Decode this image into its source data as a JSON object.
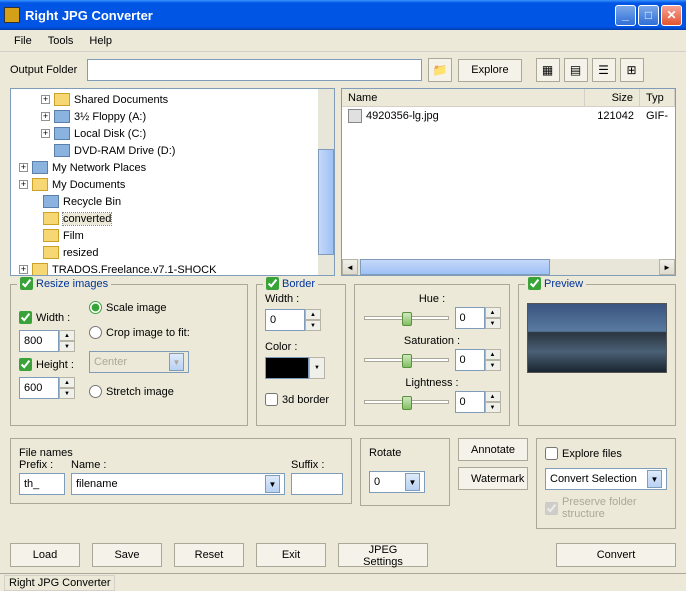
{
  "window": {
    "title": "Right JPG Converter"
  },
  "menu": {
    "file": "File",
    "tools": "Tools",
    "help": "Help"
  },
  "toolbar": {
    "output_folder_label": "Output Folder",
    "output_folder_value": "",
    "explore": "Explore"
  },
  "tree": {
    "items": [
      {
        "indent": 28,
        "expand": "+",
        "icon": "folder",
        "label": "Shared Documents"
      },
      {
        "indent": 28,
        "expand": "+",
        "icon": "special",
        "label": "3½ Floppy (A:)"
      },
      {
        "indent": 28,
        "expand": "+",
        "icon": "special",
        "label": "Local Disk (C:)"
      },
      {
        "indent": 28,
        "expand": "",
        "icon": "special",
        "label": "DVD-RAM Drive (D:)"
      },
      {
        "indent": 6,
        "expand": "+",
        "icon": "special",
        "label": "My Network Places"
      },
      {
        "indent": 6,
        "expand": "+",
        "icon": "folder",
        "label": "My Documents"
      },
      {
        "indent": 17,
        "expand": "",
        "icon": "special",
        "label": "Recycle Bin"
      },
      {
        "indent": 17,
        "expand": "",
        "icon": "folder",
        "label": "converted",
        "selected": true
      },
      {
        "indent": 17,
        "expand": "",
        "icon": "folder",
        "label": "Film"
      },
      {
        "indent": 17,
        "expand": "",
        "icon": "folder",
        "label": "resized"
      },
      {
        "indent": 6,
        "expand": "+",
        "icon": "folder",
        "label": "TRADOS.Freelance.v7.1-SHOCK"
      }
    ]
  },
  "list": {
    "cols": {
      "name": "Name",
      "size": "Size",
      "type": "Typ"
    },
    "rows": [
      {
        "name": "4920356-lg.jpg",
        "size": "121042",
        "type": "GIF-"
      }
    ]
  },
  "resize": {
    "title": "Resize images",
    "width_label": "Width :",
    "width_val": "800",
    "height_label": "Height :",
    "height_val": "600",
    "scale": "Scale image",
    "crop": "Crop image to fit:",
    "center": "Center",
    "stretch": "Stretch image"
  },
  "border": {
    "title": "Border",
    "width_label": "Width :",
    "width_val": "0",
    "color_label": "Color :",
    "threed": "3d border"
  },
  "hsl": {
    "hue": "Hue :",
    "hue_val": "0",
    "sat": "Saturation :",
    "sat_val": "0",
    "light": "Lightness :",
    "light_val": "0"
  },
  "preview": {
    "title": "Preview"
  },
  "filenames": {
    "title": "File names",
    "prefix_label": "Prefix :",
    "prefix_val": "th_",
    "name_label": "Name :",
    "name_val": "filename",
    "suffix_label": "Suffix :",
    "suffix_val": ""
  },
  "rotate": {
    "title": "Rotate",
    "val": "0"
  },
  "aw": {
    "annotate": "Annotate",
    "watermark": "Watermark"
  },
  "explore": {
    "title": "Explore files",
    "combo": "Convert Selection",
    "preserve": "Preserve folder structure"
  },
  "buttons": {
    "load": "Load",
    "save": "Save",
    "reset": "Reset",
    "exit": "Exit",
    "jpeg": "JPEG Settings",
    "convert": "Convert"
  },
  "status": "Right JPG Converter"
}
